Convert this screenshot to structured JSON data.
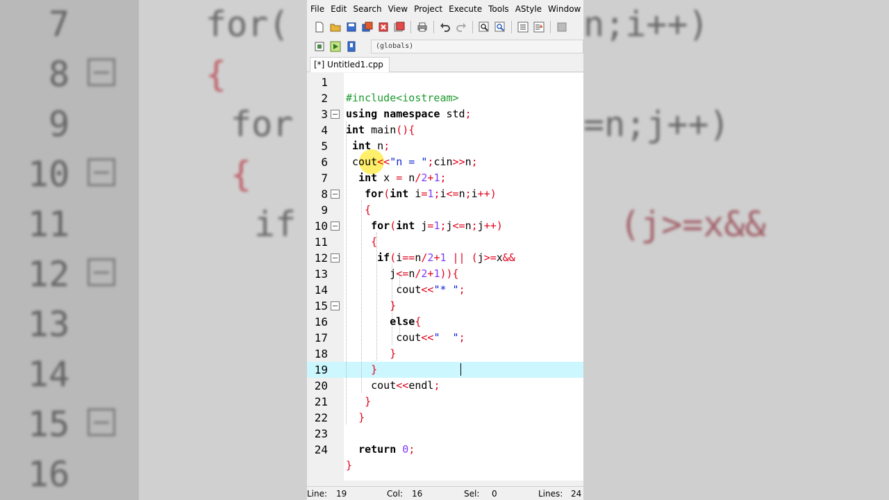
{
  "menu": [
    "File",
    "Edit",
    "Search",
    "View",
    "Project",
    "Execute",
    "Tools",
    "AStyle",
    "Window"
  ],
  "toolbar": {
    "row1_icons": [
      "new-file-icon",
      "open-file-icon",
      "save-icon",
      "save-all-icon",
      "close-icon",
      "close-all-icon",
      "print-icon",
      "undo-icon",
      "redo-icon",
      "find-icon",
      "replace-icon",
      "indent-icon",
      "unindent-icon",
      "toggle-comment-icon"
    ],
    "row2_icons": [
      "compile-icon",
      "run-icon",
      "bookmark-icon"
    ],
    "scope_dropdown": "(globals)"
  },
  "tab": {
    "label": "[*] Untitled1.cpp"
  },
  "editor": {
    "lines": [
      {
        "num": "1",
        "fold": false
      },
      {
        "num": "2",
        "fold": false
      },
      {
        "num": "3",
        "fold": true
      },
      {
        "num": "4",
        "fold": false
      },
      {
        "num": "5",
        "fold": false
      },
      {
        "num": "6",
        "fold": false
      },
      {
        "num": "7",
        "fold": false
      },
      {
        "num": "8",
        "fold": true
      },
      {
        "num": "9",
        "fold": false
      },
      {
        "num": "10",
        "fold": true
      },
      {
        "num": "11",
        "fold": false
      },
      {
        "num": "12",
        "fold": true
      },
      {
        "num": "13",
        "fold": false
      },
      {
        "num": "14",
        "fold": false
      },
      {
        "num": "15",
        "fold": true
      },
      {
        "num": "16",
        "fold": false
      },
      {
        "num": "17",
        "fold": false
      },
      {
        "num": "18",
        "fold": false
      },
      {
        "num": "19",
        "fold": false,
        "current": true
      },
      {
        "num": "20",
        "fold": false
      },
      {
        "num": "21",
        "fold": false
      },
      {
        "num": "22",
        "fold": false
      },
      {
        "num": "23",
        "fold": false
      },
      {
        "num": "24",
        "fold": false
      }
    ],
    "code": {
      "l1": "#include<iostream>",
      "l2a": "using namespace",
      "l2b": " std",
      "l2c": ";",
      "l3a": "int",
      "l3b": " main",
      "l3c": "(){",
      "l4a": "int",
      "l4b": " n",
      "l4c": ";",
      "l5a": "cout",
      "l5b": "<<",
      "l5c": "\"n = \"",
      "l5d": ";",
      "l5e": "cin",
      "l5f": ">>",
      "l5g": "n",
      "l5h": ";",
      "l6a": "int",
      "l6b": " x ",
      "l6c": "=",
      "l6d": " n",
      "l6e": "/",
      "l6f": "2",
      "l6g": "+",
      "l6h": "1",
      "l6i": ";",
      "l7a": "for",
      "l7b": "(",
      "l7c": "int",
      "l7d": " i",
      "l7e": "=",
      "l7f": "1",
      "l7g": ";",
      "l7h": "i",
      "l7i": "<=",
      "l7j": "n",
      "l7k": ";",
      "l7l": "i",
      "l7m": "++)",
      "l8": "{",
      "l9a": "for",
      "l9b": "(",
      "l9c": "int",
      "l9d": " j",
      "l9e": "=",
      "l9f": "1",
      "l9g": ";",
      "l9h": "j",
      "l9i": "<=",
      "l9j": "n",
      "l9k": ";",
      "l9l": "j",
      "l9m": "++)",
      "l10": "{",
      "l11a": "if",
      "l11b": "(",
      "l11c": "i",
      "l11d": "==",
      "l11e": "n",
      "l11f": "/",
      "l11g": "2",
      "l11h": "+",
      "l11i": "1",
      "l11j": " || (",
      "l11k": "j",
      "l11l": ">=",
      "l11m": "x",
      "l11n": "&&",
      "l12a": "j",
      "l12b": "<=",
      "l12c": "n",
      "l12d": "/",
      "l12e": "2",
      "l12f": "+",
      "l12g": "1",
      "l12h": ")){",
      "l13a": "cout",
      "l13b": "<<",
      "l13c": "\"* \"",
      "l13d": ";",
      "l14": "}",
      "l15a": "else",
      "l15b": "{",
      "l16a": "cout",
      "l16b": "<<",
      "l16c": "\"  \"",
      "l16d": ";",
      "l17": "}",
      "l18": "}",
      "l19a": "cout",
      "l19b": "<<",
      "l19c": "endl",
      "l19d": ";",
      "l20": "}",
      "l21": "}",
      "l23a": "return",
      "l23b": " 0",
      "l23c": ";",
      "l24": "}"
    }
  },
  "statusbar": {
    "line_label": "Line:",
    "line_value": "19",
    "col_label": "Col:",
    "col_value": "16",
    "sel_label": "Sel:",
    "sel_value": "0",
    "lines_label": "Lines:",
    "lines_value": "24"
  },
  "background_zoom": {
    "left_numbers": [
      "7",
      "8",
      "9",
      "10",
      "11",
      "12",
      "13",
      "14",
      "15",
      "16"
    ],
    "left_code": [
      "for(",
      "{",
      "for",
      "{",
      "if",
      "",
      "",
      "",
      "",
      ""
    ],
    "right_code": [
      "n;i++)",
      "",
      "=n;j++)",
      "",
      "(j>=x&&",
      "",
      "",
      "",
      "",
      ""
    ]
  },
  "colors": {
    "current_line": "#ccf7ff",
    "preprocessor": "#1b9a2e",
    "string": "#0a1fd6",
    "number": "#7c3aff",
    "symbol": "#e0001b"
  }
}
